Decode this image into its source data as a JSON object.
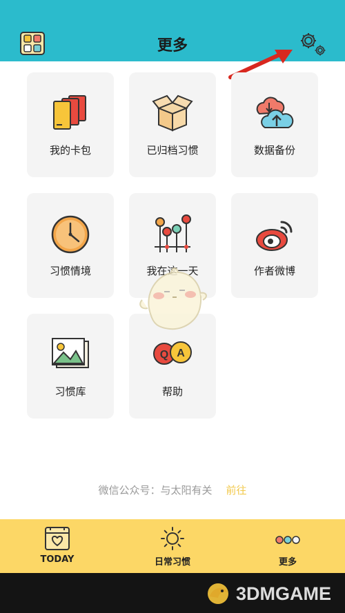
{
  "header": {
    "title": "更多"
  },
  "cards": [
    {
      "label": "我的卡包",
      "icon": "card-pack-icon"
    },
    {
      "label": "已归档习惯",
      "icon": "archive-box-icon"
    },
    {
      "label": "数据备份",
      "icon": "cloud-backup-icon"
    },
    {
      "label": "习惯情境",
      "icon": "clock-icon"
    },
    {
      "label": "我在这一天",
      "icon": "timeline-icon"
    },
    {
      "label": "作者微博",
      "icon": "weibo-icon"
    },
    {
      "label": "习惯库",
      "icon": "picture-library-icon"
    },
    {
      "label": "帮助",
      "icon": "qa-bubbles-icon"
    }
  ],
  "footer": {
    "wechat": "微信公众号：与太阳有关",
    "go": "前往"
  },
  "tabs": [
    {
      "label": "TODAY",
      "icon": "calendar-heart-icon"
    },
    {
      "label": "日常习惯",
      "icon": "sun-icon"
    },
    {
      "label": "更多",
      "icon": "three-dots-icon"
    }
  ],
  "watermark": {
    "text": "3DMGAME"
  },
  "colors": {
    "header": "#2bbbcc",
    "tabbar": "#fcd766",
    "card": "#f4f4f4",
    "link": "#f2c94c",
    "arrow": "#d8281f"
  }
}
